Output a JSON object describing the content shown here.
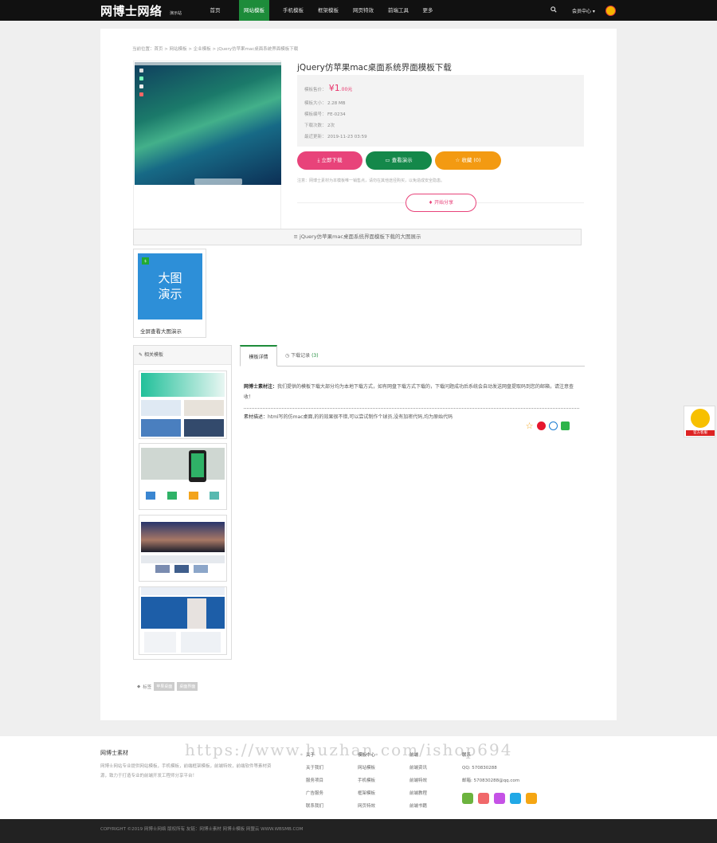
{
  "header": {
    "logo": "网博士网络",
    "logo_sub": "演示站",
    "nav": [
      "首页",
      "网站模板",
      "手机模板",
      "框架模板",
      "网页特效",
      "前端工具",
      "更多"
    ],
    "member": "会员中心 ▾"
  },
  "breadcrumb": "当前位置：首页 > 网站模板 > 企业模板 > jQuery仿苹果mac桌面系统界面模板下载",
  "product": {
    "title": "jQuery仿苹果mac桌面系统界面模板下载",
    "price_label": "模板售价：",
    "price": "¥1",
    "price_unit": ".00元",
    "size_label": "模板大小：",
    "size": "2.28 MB",
    "code_label": "模板编号：",
    "code": "FE-0234",
    "downloads_label": "下载次数：",
    "downloads": "2次",
    "updated_label": "最近更新：",
    "updated": "2019-11-23 03:59"
  },
  "buttons": {
    "download": "立即下载",
    "demo": "查看演示",
    "favorite": "收藏 (0)",
    "share": "开始分享"
  },
  "note": "注意：网博士素材为本模板唯一销售点，请勿在其他途径购买，以免造成安全隐患。",
  "section_bar": "jQuery仿苹果mac桌面系统界面模板下载的大图展示",
  "demo_card": {
    "img_text1": "大图",
    "img_text2": "演示",
    "caption": "全屏查看大图演示"
  },
  "sidebar": {
    "title": "相关模板"
  },
  "tabs": {
    "detail": "模板详情",
    "records": "下载记录",
    "records_count": "(3)"
  },
  "content": {
    "intro_label": "网博士素材注：",
    "intro": "我们提供的模板下载大部分均为本地下载方式，如有网盘下载方式下载的，下载问题成功后系统会自动发送网盘提取码到您的邮箱，请注意查收！",
    "desc_label": "素材描述：",
    "desc": "html写的仿mac桌面,的的效果很不错,可以尝试制作个球员,没有加密代码,均为原始代码"
  },
  "tags": {
    "label": "标签",
    "items": [
      "苹果桌面",
      "桌面界面"
    ]
  },
  "footer": {
    "brand": "网博士素材",
    "desc": "网博士网站专业提供网站模板，手机模板，前端框架模板，前端特效，前端软件等素材资源，致力于打造专业的前端开发工程师分享平台！",
    "cols": [
      {
        "head": "关于",
        "items": [
          "关于我们",
          "服务项目",
          "广告服务",
          "联系我们"
        ]
      },
      {
        "head": "模板中心",
        "items": [
          "网站模板",
          "手机模板",
          "框架模板",
          "网页特效"
        ]
      },
      {
        "head": "前端",
        "items": [
          "前端资讯",
          "前端特效",
          "前端教程",
          "前端书籍"
        ]
      },
      {
        "head": "联系",
        "items": [
          "QQ: 570830288",
          "邮箱: 570830288@qq.com"
        ]
      }
    ],
    "watermark": "https://www.huzhan.com/ishop694",
    "copyright": "COPYRIGHT ©2019 网博士网络 版权所有 友链：网博士素材 网博士模板 网盟云 WWW.WBSMB.COM"
  },
  "float": {
    "label": "官方客服"
  },
  "colors": {
    "accent_green": "#1d8c3a",
    "pink": "#e8437a",
    "orange": "#f39a12"
  }
}
